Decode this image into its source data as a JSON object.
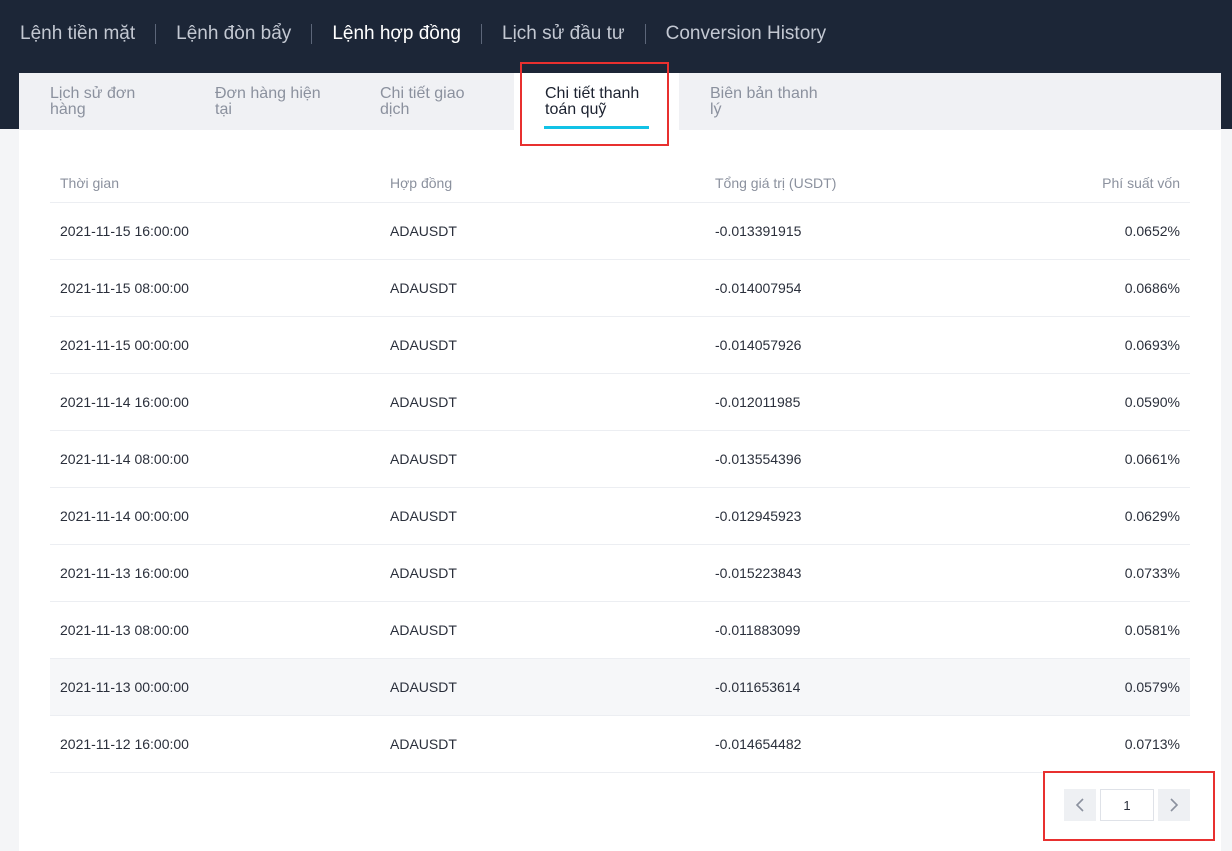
{
  "topnav": {
    "items": [
      {
        "label": "Lệnh tiền mặt",
        "active": false
      },
      {
        "label": "Lệnh đòn bẩy",
        "active": false
      },
      {
        "label": "Lệnh hợp đồng",
        "active": true
      },
      {
        "label": "Lịch sử đầu tư",
        "active": false
      },
      {
        "label": "Conversion History",
        "active": false
      }
    ]
  },
  "tabs": [
    {
      "label": "Lịch sử đơn hàng",
      "active": false
    },
    {
      "label": "Đơn hàng hiện tại",
      "active": false
    },
    {
      "label": "Chi tiết giao dịch",
      "active": false
    },
    {
      "label": "Chi tiết thanh toán quỹ",
      "active": true
    },
    {
      "label": "Biên bản thanh lý",
      "active": false
    }
  ],
  "table": {
    "headers": [
      "Thời gian",
      "Hợp đồng",
      "Tổng giá trị (USDT)",
      "Phí suất vốn"
    ],
    "rows": [
      [
        "2021-11-15 16:00:00",
        "ADAUSDT",
        "-0.013391915",
        "0.0652%"
      ],
      [
        "2021-11-15 08:00:00",
        "ADAUSDT",
        "-0.014007954",
        "0.0686%"
      ],
      [
        "2021-11-15 00:00:00",
        "ADAUSDT",
        "-0.014057926",
        "0.0693%"
      ],
      [
        "2021-11-14 16:00:00",
        "ADAUSDT",
        "-0.012011985",
        "0.0590%"
      ],
      [
        "2021-11-14 08:00:00",
        "ADAUSDT",
        "-0.013554396",
        "0.0661%"
      ],
      [
        "2021-11-14 00:00:00",
        "ADAUSDT",
        "-0.012945923",
        "0.0629%"
      ],
      [
        "2021-11-13 16:00:00",
        "ADAUSDT",
        "-0.015223843",
        "0.0733%"
      ],
      [
        "2021-11-13 08:00:00",
        "ADAUSDT",
        "-0.011883099",
        "0.0581%"
      ],
      [
        "2021-11-13 00:00:00",
        "ADAUSDT",
        "-0.011653614",
        "0.0579%"
      ],
      [
        "2021-11-12 16:00:00",
        "ADAUSDT",
        "-0.014654482",
        "0.0713%"
      ]
    ],
    "hover_row": 8
  },
  "pagination": {
    "current_page": "1",
    "prev_icon": "chevron-left-icon",
    "next_icon": "chevron-right-icon"
  },
  "colors": {
    "header_bg": "#1c2637",
    "accent": "#12c2e6",
    "highlight": "#e8302f"
  }
}
